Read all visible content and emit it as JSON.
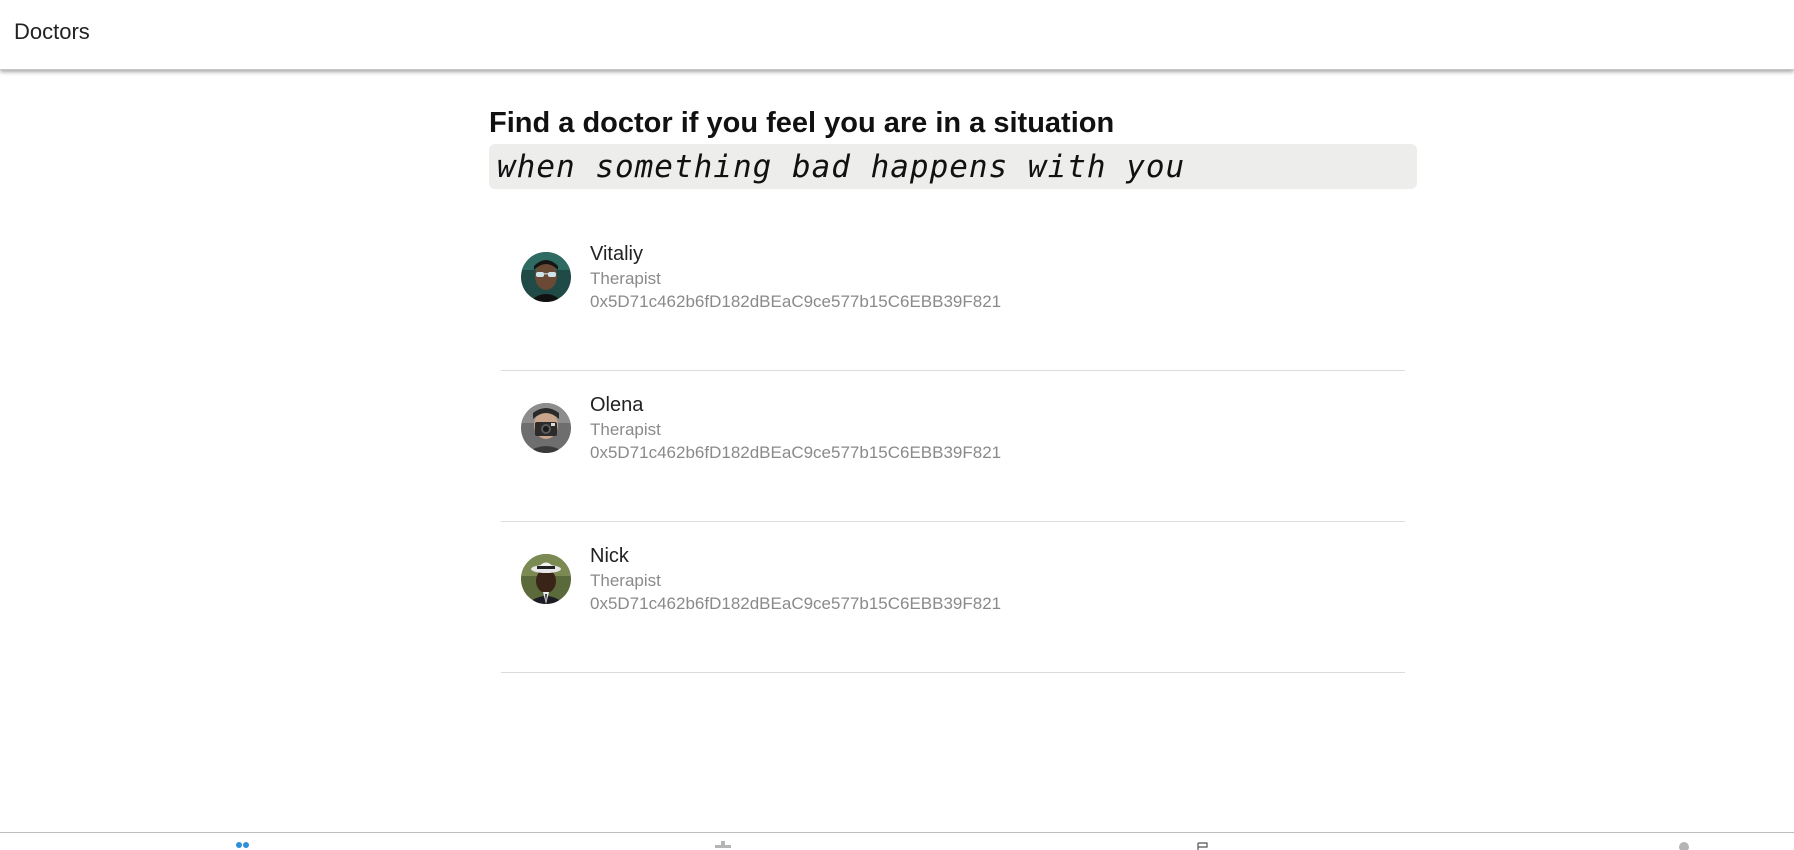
{
  "header": {
    "title": "Doctors"
  },
  "main": {
    "headline": "Find a doctor if you feel you are in a situation",
    "quote": "when something bad happens with you"
  },
  "doctors": [
    {
      "name": "Vitaliy",
      "role": "Therapist",
      "address": "0x5D71c462b6fD182dBEaC9ce577b15C6EBB39F821",
      "avatar_icon": "person-with-sunglasses-photo"
    },
    {
      "name": "Olena",
      "role": "Therapist",
      "address": "0x5D71c462b6fD182dBEaC9ce577b15C6EBB39F821",
      "avatar_icon": "person-with-camera-photo"
    },
    {
      "name": "Nick",
      "role": "Therapist",
      "address": "0x5D71c462b6fD182dBEaC9ce577b15C6EBB39F821",
      "avatar_icon": "person-with-hat-photo"
    }
  ],
  "bottom_nav": {
    "tabs": [
      {
        "icon": "people-icon",
        "active": true
      },
      {
        "icon": "medical-icon",
        "active": false
      },
      {
        "icon": "flag-icon",
        "active": false
      },
      {
        "icon": "profile-icon",
        "active": false
      }
    ]
  },
  "colors": {
    "accent": "#2f8fd8",
    "inactive_icon": "#b5b5b5",
    "secondary_text": "#8a8a8a",
    "quote_background": "#ededec"
  }
}
